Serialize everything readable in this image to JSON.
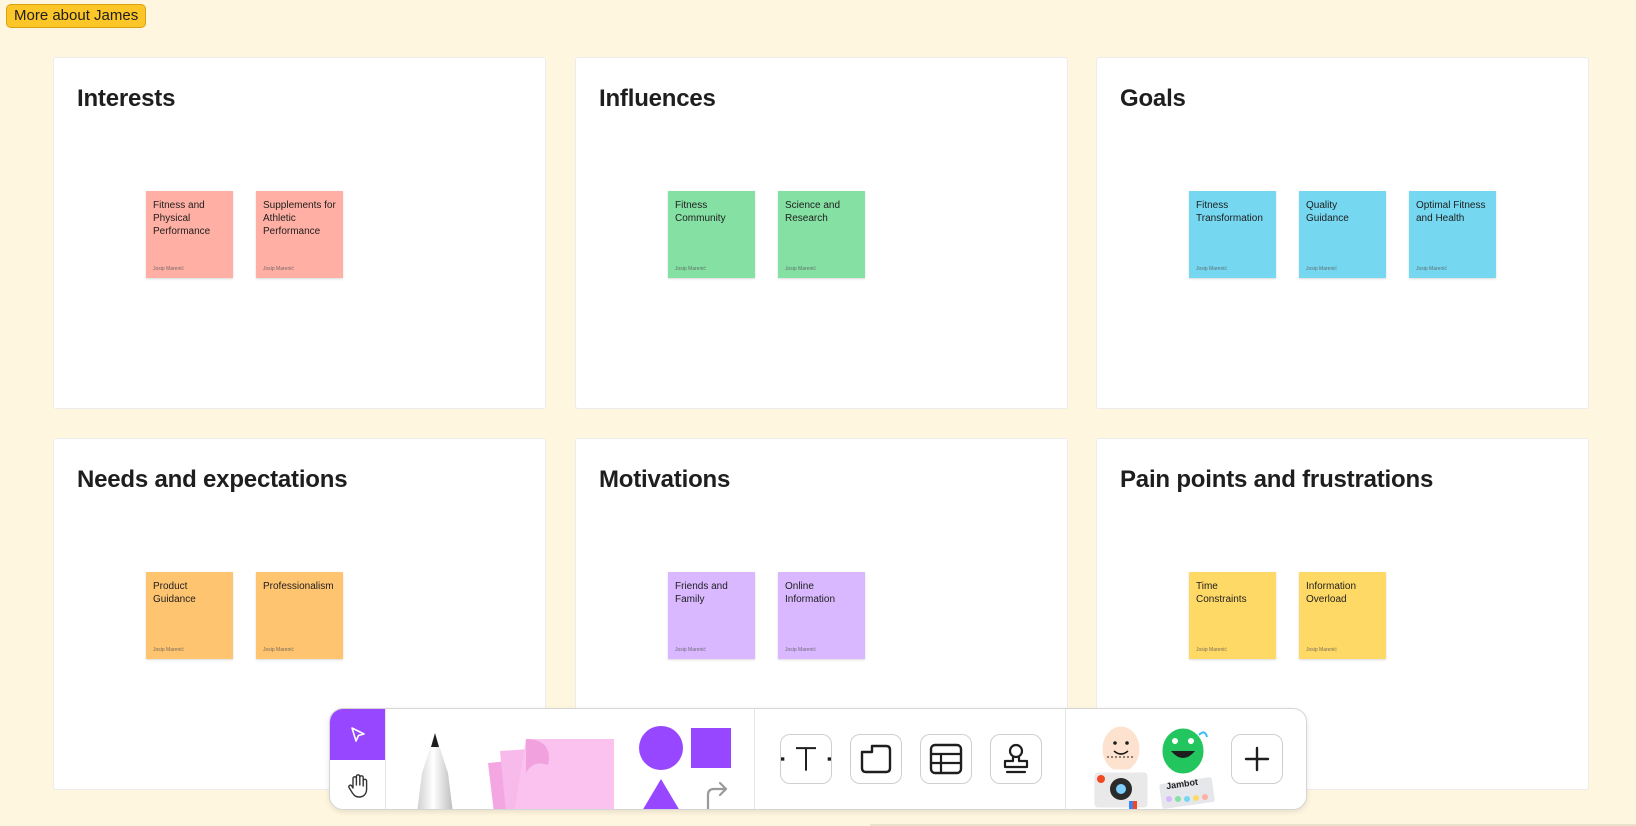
{
  "section": {
    "label": "More about James"
  },
  "panels": [
    {
      "title": "Interests",
      "stickies": [
        {
          "text": "Fitness and Physical Performance",
          "author": "Josip Marenić"
        },
        {
          "text": "Supplements for Athletic Performance",
          "author": "Josip Marenić"
        }
      ]
    },
    {
      "title": "Influences",
      "stickies": [
        {
          "text": "Fitness Community",
          "author": "Josip Marenić"
        },
        {
          "text": "Science and Research",
          "author": "Josip Marenić"
        }
      ]
    },
    {
      "title": "Goals",
      "stickies": [
        {
          "text": "Fitness Transformation",
          "author": "Josip Marenić"
        },
        {
          "text": "Quality Guidance",
          "author": "Josip Marenić"
        },
        {
          "text": "Optimal Fitness and Health",
          "author": "Josip Marenić"
        }
      ]
    },
    {
      "title": "Needs and expectations",
      "stickies": [
        {
          "text": "Product Guidance",
          "author": "Josip Marenić"
        },
        {
          "text": "Professionalism",
          "author": "Josip Marenić"
        }
      ]
    },
    {
      "title": "Motivations",
      "stickies": [
        {
          "text": "Friends and Family",
          "author": "Josip Marenić"
        },
        {
          "text": "Online Information",
          "author": "Josip Marenić"
        }
      ]
    },
    {
      "title": "Pain points and frustrations",
      "stickies": [
        {
          "text": "Time Constraints",
          "author": "Josip Marenić"
        },
        {
          "text": "Information Overload",
          "author": "Josip Marenić"
        }
      ]
    }
  ],
  "colors": {
    "canvas": "#fff6df",
    "interests": "#ffafa3",
    "influences": "#85e0a3",
    "goals": "#75d7f0",
    "needs": "#ffc470",
    "motivations": "#d9b8ff",
    "pain_points": "#ffd966",
    "accent": "#9747ff"
  },
  "toolbar": {
    "tools": [
      "select-tool",
      "hand-tool",
      "pencil-tool",
      "sticky-note-tool",
      "shapes-tool",
      "text-tool",
      "section-tool",
      "table-tool",
      "stamp-tool",
      "widgets",
      "add-more"
    ],
    "sticker_label": "Jambot"
  }
}
